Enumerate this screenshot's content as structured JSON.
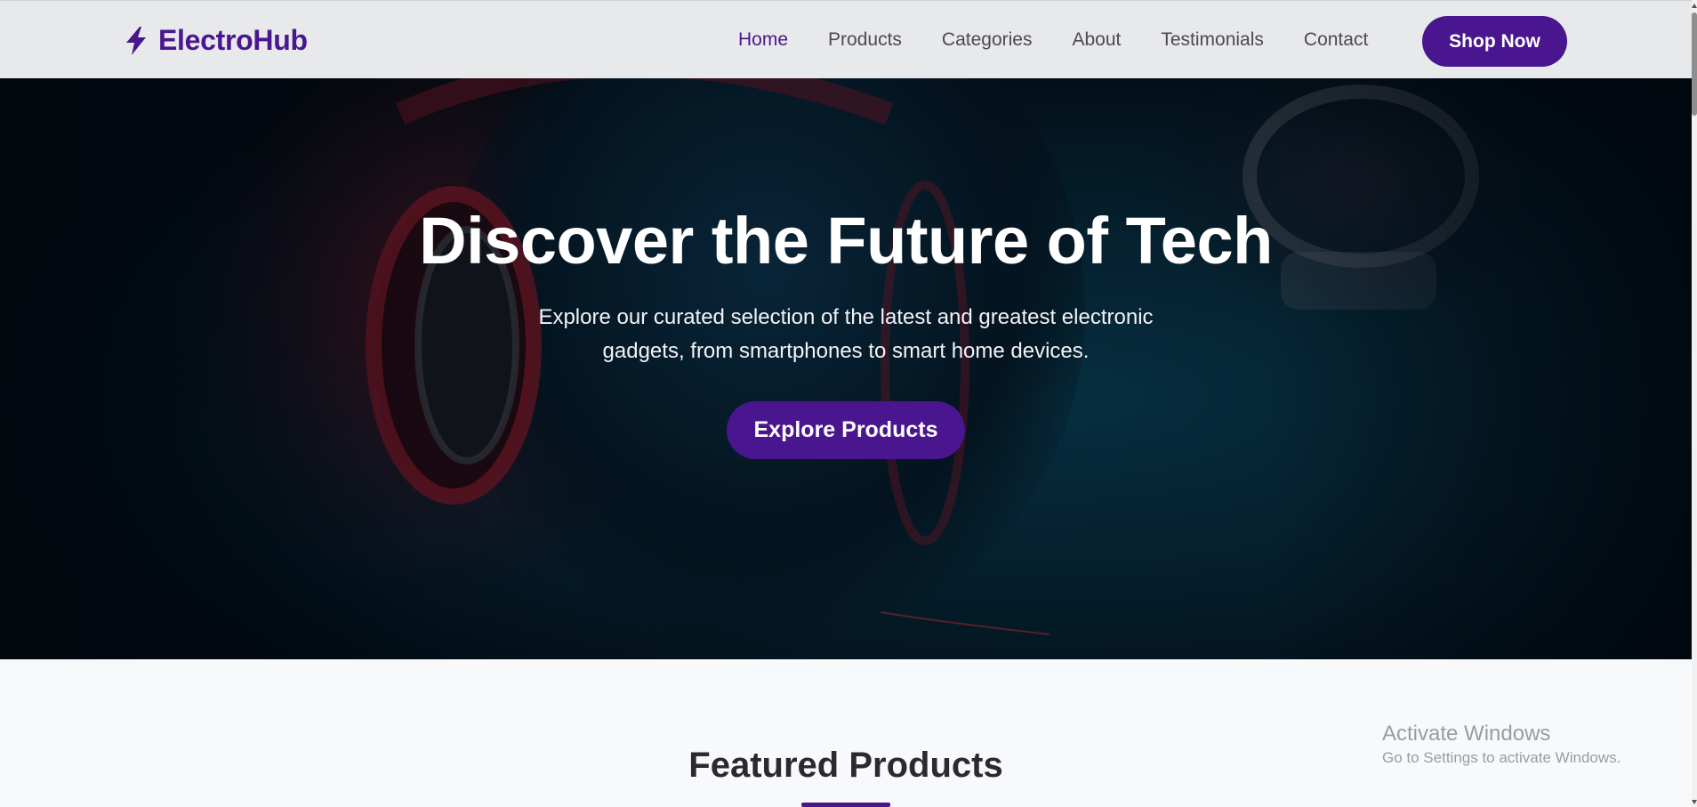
{
  "brand": {
    "name": "ElectroHub",
    "icon": "lightning-bolt-icon",
    "color": "#4a168f"
  },
  "nav": {
    "items": [
      {
        "label": "Home",
        "active": true
      },
      {
        "label": "Products",
        "active": false
      },
      {
        "label": "Categories",
        "active": false
      },
      {
        "label": "About",
        "active": false
      },
      {
        "label": "Testimonials",
        "active": false
      },
      {
        "label": "Contact",
        "active": false
      }
    ],
    "cta_label": "Shop Now"
  },
  "hero": {
    "title": "Discover the Future of Tech",
    "subtitle": "Explore our curated selection of the latest and greatest electronic gadgets, from smartphones to smart home devices.",
    "button_label": "Explore Products"
  },
  "featured": {
    "title": "Featured Products"
  },
  "watermark": {
    "title": "Activate Windows",
    "subtitle": "Go to Settings to activate Windows."
  },
  "colors": {
    "accent": "#4a168f",
    "header_bg": "#e8e9eb",
    "page_bg": "#f8f9fb",
    "nav_text": "#4b4b50"
  }
}
